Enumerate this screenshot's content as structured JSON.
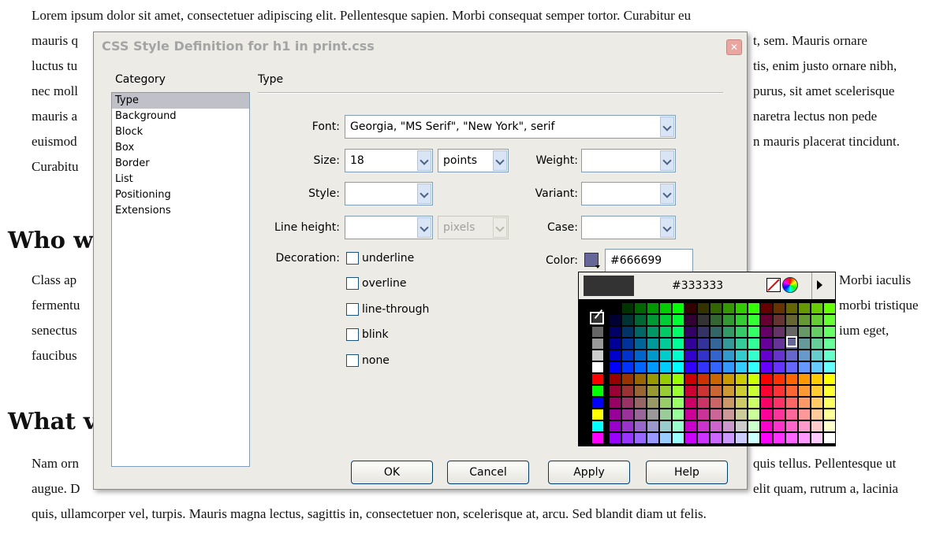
{
  "page": {
    "para1_lines": [
      "Lorem ipsum dolor sit amet, consectetuer adipiscing elit. Pellentesque sapien. Morbi consequat semper tortor. Curabitur eu",
      "mauris q",
      "luctus tu",
      "nec moll",
      "mauris a",
      "euismod",
      "Curabitu"
    ],
    "para1_right": [
      "",
      "t, sem. Mauris ornare",
      "tis, enim justo ornare nibh,",
      "purus, sit amet scelerisque",
      "naretra lectus non pede",
      "n mauris placerat tincidunt.",
      ""
    ],
    "heading1": "Who w",
    "para2_lines": [
      "Class ap",
      "fermentu",
      "senectus",
      "faucibus"
    ],
    "para2_right": [
      "Morbi iaculis",
      "morbi tristique",
      "ium eget,",
      ""
    ],
    "heading2": "What v",
    "para3_lines": [
      "Nam orn",
      "augue. D",
      "quis, ullamcorper vel, turpis. Mauris magna lectus, sagittis in, consectetuer non, scelerisque at, arcu. Sed blandit diam ut felis."
    ],
    "para3_right": [
      "quis tellus. Pellentesque ut",
      "elit quam, rutrum a, lacinia",
      ""
    ]
  },
  "dialog": {
    "title": "CSS Style Definition for h1 in print.css",
    "close_icon": "close-icon",
    "category_label": "Category",
    "categories": [
      {
        "label": "Type",
        "selected": true
      },
      {
        "label": "Background",
        "selected": false
      },
      {
        "label": "Block",
        "selected": false
      },
      {
        "label": "Box",
        "selected": false
      },
      {
        "label": "Border",
        "selected": false
      },
      {
        "label": "List",
        "selected": false
      },
      {
        "label": "Positioning",
        "selected": false
      },
      {
        "label": "Extensions",
        "selected": false
      }
    ],
    "section_title": "Type",
    "font": {
      "label": "Font:",
      "value": "Georgia, \"MS Serif\", \"New York\", serif"
    },
    "size": {
      "label": "Size:",
      "value": "18",
      "unit": "points"
    },
    "weight": {
      "label": "Weight:",
      "value": ""
    },
    "style": {
      "label": "Style:",
      "value": ""
    },
    "variant": {
      "label": "Variant:",
      "value": ""
    },
    "line_height": {
      "label": "Line height:",
      "value": "",
      "unit": "pixels"
    },
    "case": {
      "label": "Case:",
      "value": ""
    },
    "decoration": {
      "label": "Decoration:",
      "options": [
        "underline",
        "overline",
        "line-through",
        "blink",
        "none"
      ]
    },
    "color": {
      "label": "Color:",
      "value": "#666699",
      "swatch": "#666699"
    },
    "buttons": {
      "ok": "OK",
      "cancel": "Cancel",
      "apply": "Apply",
      "help": "Help"
    }
  },
  "picker": {
    "hex": "#333333",
    "preview": "#333333",
    "no_color_icon": "no-color-icon",
    "system_color_icon": "color-wheel-icon",
    "menu_icon": "menu-arrow-icon"
  }
}
